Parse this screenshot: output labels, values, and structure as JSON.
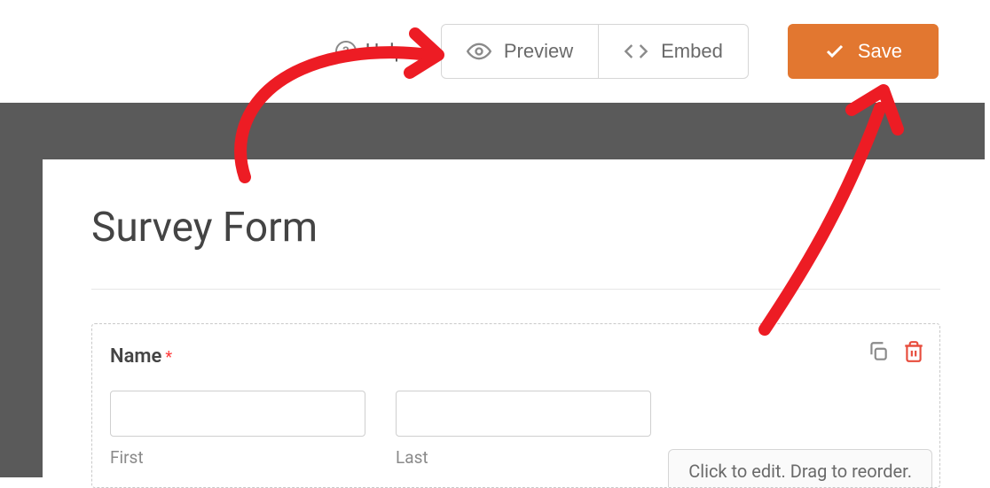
{
  "toolbar": {
    "help_label": "Help",
    "preview_label": "Preview",
    "embed_label": "Embed",
    "save_label": "Save"
  },
  "form": {
    "title": "Survey Form",
    "name_field": {
      "label": "Name",
      "required_marker": "*",
      "first_value": "",
      "last_value": "",
      "first_sublabel": "First",
      "last_sublabel": "Last",
      "hint": "Click to edit. Drag to reorder."
    }
  },
  "icons": {
    "help": "help-icon",
    "eye": "eye-icon",
    "code": "code-icon",
    "check": "check-icon",
    "duplicate": "duplicate-icon",
    "trash": "trash-icon"
  },
  "colors": {
    "accent": "#e27730",
    "danger": "#e74c3c",
    "annotation": "#ed1c24"
  }
}
